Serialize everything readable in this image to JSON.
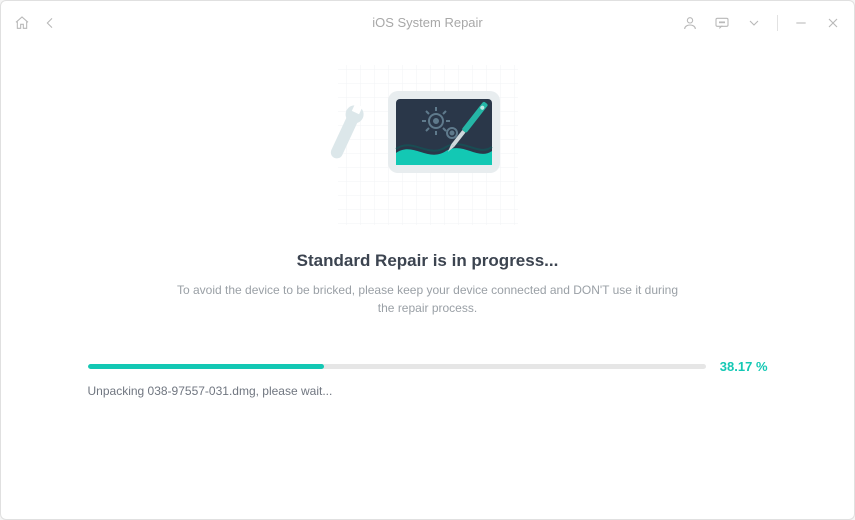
{
  "window": {
    "title": "iOS System Repair"
  },
  "titlebar": {
    "home_icon": "home",
    "back_icon": "back",
    "user_icon": "user",
    "feedback_icon": "feedback",
    "dropdown_icon": "chevron-down",
    "minimize_icon": "minimize",
    "close_icon": "close"
  },
  "main": {
    "heading": "Standard Repair is in progress...",
    "subtext": "To avoid the device to be bricked, please keep your device connected and DON'T use it during the repair process."
  },
  "progress": {
    "percent_value": 38.17,
    "percent_label": "38.17 %",
    "status": "Unpacking 038-97557-031.dmg, please wait..."
  },
  "colors": {
    "accent": "#13c8b4",
    "text_muted": "#9aa0a6",
    "heading": "#3c4450"
  }
}
